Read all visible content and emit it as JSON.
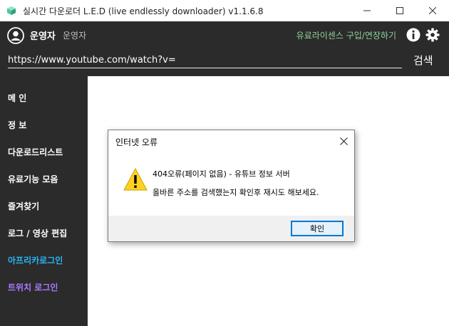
{
  "window": {
    "title": "실시간 다운로더 L.E.D (live endlessly downloader) v1.1.6.8",
    "icons": [
      "app-icon",
      "minimize-icon",
      "maximize-icon",
      "close-icon"
    ]
  },
  "header": {
    "user_name": "운영자",
    "user_role": "운영자",
    "license_link": "유료라이센스 구입/연장하기",
    "url_value": "https://www.youtube.com/watch?v=",
    "search_label": "검색",
    "icons": [
      "user-icon",
      "info-icon",
      "gear-icon"
    ]
  },
  "sidebar": {
    "items": [
      {
        "label": "메 인",
        "color": "#ffffff"
      },
      {
        "label": "정 보",
        "color": "#ffffff"
      },
      {
        "label": "다운로드리스트",
        "color": "#ffffff"
      },
      {
        "label": "유료기능 모음",
        "color": "#ffffff"
      },
      {
        "label": "즐겨찾기",
        "color": "#ffffff"
      },
      {
        "label": "로그 / 영상 편집",
        "color": "#ffffff"
      },
      {
        "label": "아프리카로그인",
        "color": "#29b6f6"
      },
      {
        "label": "트위치 로그인",
        "color": "#a97bff"
      }
    ]
  },
  "dialog": {
    "title": "인터넷 오류",
    "line1": "404오류(페이지 없음) - 유튜브 정보 서버",
    "line2": "올바른 주소를 검색했는지 확인후 재시도 해보세요.",
    "ok_label": "확인",
    "icons": [
      "warning-icon",
      "close-icon"
    ]
  },
  "colors": {
    "dark_bg": "#2b2b2b",
    "accent_green": "#8fd3a0",
    "afreeca_blue": "#29b6f6",
    "twitch_purple": "#a97bff",
    "focus_blue": "#0078d7"
  }
}
